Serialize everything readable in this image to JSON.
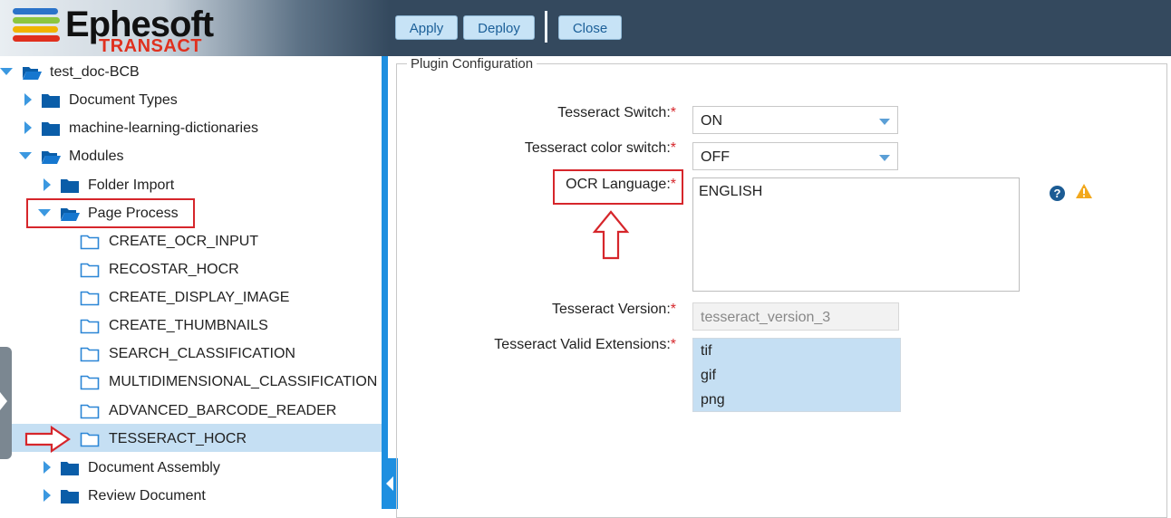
{
  "header": {
    "brand": "Ephesoft",
    "sub_brand": "TRANSACT",
    "apply_label": "Apply",
    "deploy_label": "Deploy",
    "close_label": "Close"
  },
  "tree": {
    "root": "test_doc-BCB",
    "document_types": "Document Types",
    "ml_dictionaries": "machine-learning-dictionaries",
    "modules": "Modules",
    "folder_import": "Folder Import",
    "page_process": "Page Process",
    "plugins": [
      "CREATE_OCR_INPUT",
      "RECOSTAR_HOCR",
      "CREATE_DISPLAY_IMAGE",
      "CREATE_THUMBNAILS",
      "SEARCH_CLASSIFICATION",
      "MULTIDIMENSIONAL_CLASSIFICATION",
      "ADVANCED_BARCODE_READER",
      "TESSERACT_HOCR"
    ],
    "document_assembly": "Document Assembly",
    "review_document": "Review Document",
    "selected": "TESSERACT_HOCR"
  },
  "config": {
    "legend": "Plugin Configuration",
    "tesseract_switch_label": "Tesseract Switch:",
    "tesseract_switch_value": "ON",
    "color_switch_label": "Tesseract color switch:",
    "color_switch_value": "OFF",
    "ocr_language_label": "OCR Language:",
    "ocr_language_value": "ENGLISH",
    "version_label": "Tesseract Version:",
    "version_value": "tesseract_version_3",
    "extensions_label": "Tesseract Valid Extensions:",
    "extensions": [
      "tif",
      "gif",
      "png"
    ],
    "required_mark": "*",
    "help_glyph": "?"
  },
  "colors": {
    "accent": "#1e8fe0",
    "selection": "#c5dff3",
    "annotation": "#d6262b",
    "header": "#34495e"
  },
  "icons": [
    "folder-open-icon",
    "folder-closed-icon",
    "folder-outline-icon",
    "help-icon",
    "warning-icon",
    "caret-down-icon",
    "collapse-left-icon"
  ]
}
